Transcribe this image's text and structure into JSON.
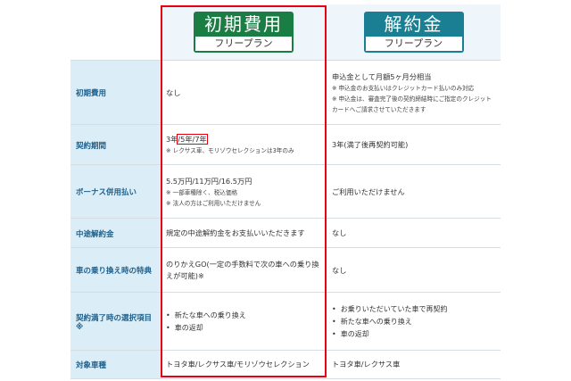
{
  "headers": {
    "plan_a": {
      "title": "初期費用",
      "subtitle": "フリープラン"
    },
    "plan_b": {
      "title": "解約金",
      "subtitle": "フリープラン"
    }
  },
  "rows": [
    {
      "label": "初期費用",
      "a_main": "なし",
      "b_main": "申込金として月額5ヶ月分相当",
      "b_note1": "※ 申込金のお支払いはクレジットカード払いのみ対応",
      "b_note2": "※ 申込金は、審査完了後の契約締結時にご指定のクレジットカードへご請求させていただきます"
    },
    {
      "label": "契約期間",
      "a_main_prefix": "3年",
      "a_main_hl": "/5年/7年",
      "a_note": "※ レクサス車、モリゾウセレクションは3年のみ",
      "b_main": "3年(満了後再契約可能)"
    },
    {
      "label": "ボーナス併用払い",
      "a_main": "5.5万円/11万円/16.5万円",
      "a_note1": "※ 一部車種除く、税込価格",
      "a_note2": "※ 法人の方はご利用いただけません",
      "b_main": "ご利用いただけません"
    },
    {
      "label": "中途解約金",
      "a_main": "規定の中途解約金をお支払いいただきます",
      "b_main": "なし"
    },
    {
      "label": "車の乗り換え時の特典",
      "a_main": "のりかえGO(一定の手数料で次の車への乗り換えが可能)※",
      "b_main": "なし"
    },
    {
      "label": "契約満了時の選択項目※",
      "a_items": [
        "新たな車への乗り換え",
        "車の返却"
      ],
      "b_items": [
        "お乗りいただいていた車で再契約",
        "新たな車への乗り換え",
        "車の返却"
      ]
    },
    {
      "label": "対象車種",
      "a_main": "トヨタ車/レクサス車/モリゾウセレクション",
      "b_main": "トヨタ車/レクサス車"
    }
  ],
  "colors": {
    "plan_a_badge": "#1a7e44",
    "plan_b_badge": "#1b7f93",
    "label_bg": "#dbeef7",
    "label_text": "#1d5f8a",
    "highlight": "#e60012"
  }
}
